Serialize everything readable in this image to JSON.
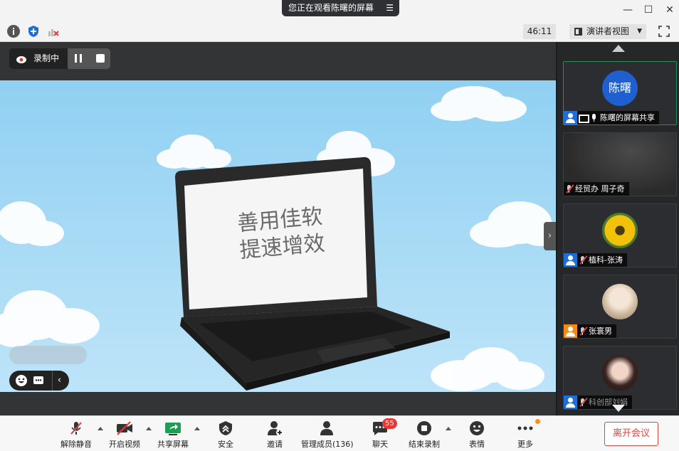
{
  "banner": {
    "text": "您正在观看陈曙的屏幕"
  },
  "toolbar": {
    "timer": "46:11",
    "view_mode": "演讲者视图"
  },
  "recording": {
    "label": "录制中"
  },
  "shared_screen": {
    "laptop_text_line1": "善用佳软",
    "laptop_text_line2": "提速增效"
  },
  "participants": [
    {
      "name": "陈曙的屏幕共享",
      "avatar_text": "陈曙",
      "avatar_color": "#1f5fcf",
      "host": true,
      "mic": "on",
      "sharing": true
    },
    {
      "name": "经贸办 周子奇",
      "mic": "off"
    },
    {
      "name": "植科-张涛",
      "host": true,
      "mic": "off"
    },
    {
      "name": "张寰男",
      "host": true,
      "mic": "off"
    },
    {
      "name": "科创部刘娟",
      "host": true,
      "mic": "off"
    }
  ],
  "controls": {
    "unmute": "解除静音",
    "video": "开启视频",
    "share": "共享屏幕",
    "security": "安全",
    "invite": "邀请",
    "members": "管理成员(136)",
    "chat": "聊天",
    "chat_badge": "55",
    "stop_record": "结束录制",
    "reactions": "表情",
    "more": "更多",
    "leave": "离开会议"
  },
  "colors": {
    "leave": "#e0443e",
    "host_badge": "#1d6fd6",
    "active_border": "#2a8c5a"
  }
}
